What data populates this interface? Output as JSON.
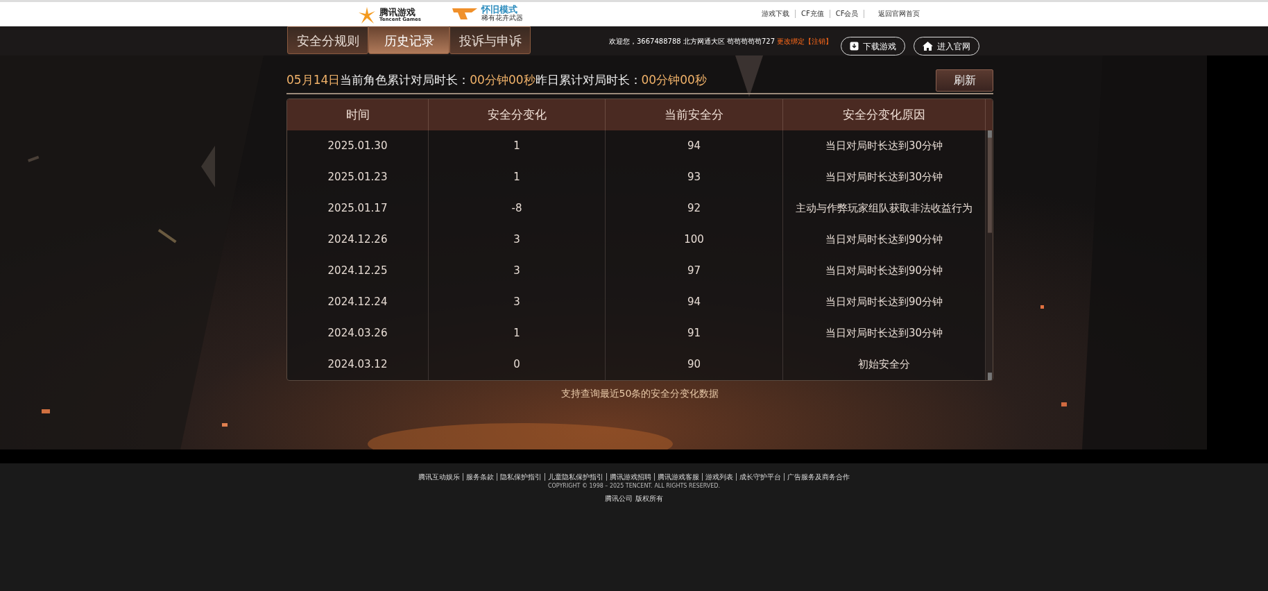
{
  "top_bar": {
    "brand": {
      "name": "腾讯游戏",
      "sub": "Tencent Games"
    },
    "mode": {
      "title": "怀旧模式",
      "sub": "稀有花卉武器"
    },
    "links": [
      "游戏下载",
      "CF充值",
      "CF会员",
      "返回官网首页"
    ]
  },
  "tabs": [
    {
      "label": "安全分规则",
      "selected": false
    },
    {
      "label": "历史记录",
      "selected": true
    },
    {
      "label": "投诉与申诉",
      "selected": false
    }
  ],
  "user": {
    "welcome": "欢迎您，3667488788 北方网通大区 苟苟苟苟苟727",
    "change_link": "更改绑定",
    "logout_link": "【注销】"
  },
  "header_buttons": [
    "下载游戏",
    "进入官网"
  ],
  "summary": [
    {
      "text": "05月14日",
      "highlight": true
    },
    {
      "text": "当前角色累计对局时长：",
      "highlight": false
    },
    {
      "text": "00分钟00秒",
      "highlight": true
    },
    {
      "text": "昨日累计对局时长：",
      "highlight": false
    },
    {
      "text": "00分钟00秒",
      "highlight": true
    }
  ],
  "refresh_button": "刷新",
  "table": {
    "columns": [
      "时间",
      "安全分变化",
      "当前安全分",
      "安全分变化原因"
    ],
    "rows": [
      [
        "2025.01.30",
        "1",
        "94",
        "当日对局时长达到30分钟"
      ],
      [
        "2025.01.23",
        "1",
        "93",
        "当日对局时长达到30分钟"
      ],
      [
        "2025.01.17",
        "-8",
        "92",
        "主动与作弊玩家组队获取非法收益行为"
      ],
      [
        "2024.12.26",
        "3",
        "100",
        "当日对局时长达到90分钟"
      ],
      [
        "2024.12.25",
        "3",
        "97",
        "当日对局时长达到90分钟"
      ],
      [
        "2024.12.24",
        "3",
        "94",
        "当日对局时长达到90分钟"
      ],
      [
        "2024.03.26",
        "1",
        "91",
        "当日对局时长达到30分钟"
      ],
      [
        "2024.03.12",
        "0",
        "90",
        "初始安全分"
      ]
    ]
  },
  "note": "支持查询最近50条的安全分变化数据",
  "footer": {
    "links": [
      "腾讯互动娱乐",
      "服务条款",
      "隐私保护指引",
      "儿童隐私保护指引",
      "腾讯游戏招聘",
      "腾讯游戏客服",
      "游戏列表",
      "成长守护平台",
      "广告服务及商务合作"
    ],
    "copyright": "COPYRIGHT © 1998 – 2025 TENCENT. ALL RIGHTS RESERVED.",
    "company": "腾讯公司 版权所有"
  }
}
